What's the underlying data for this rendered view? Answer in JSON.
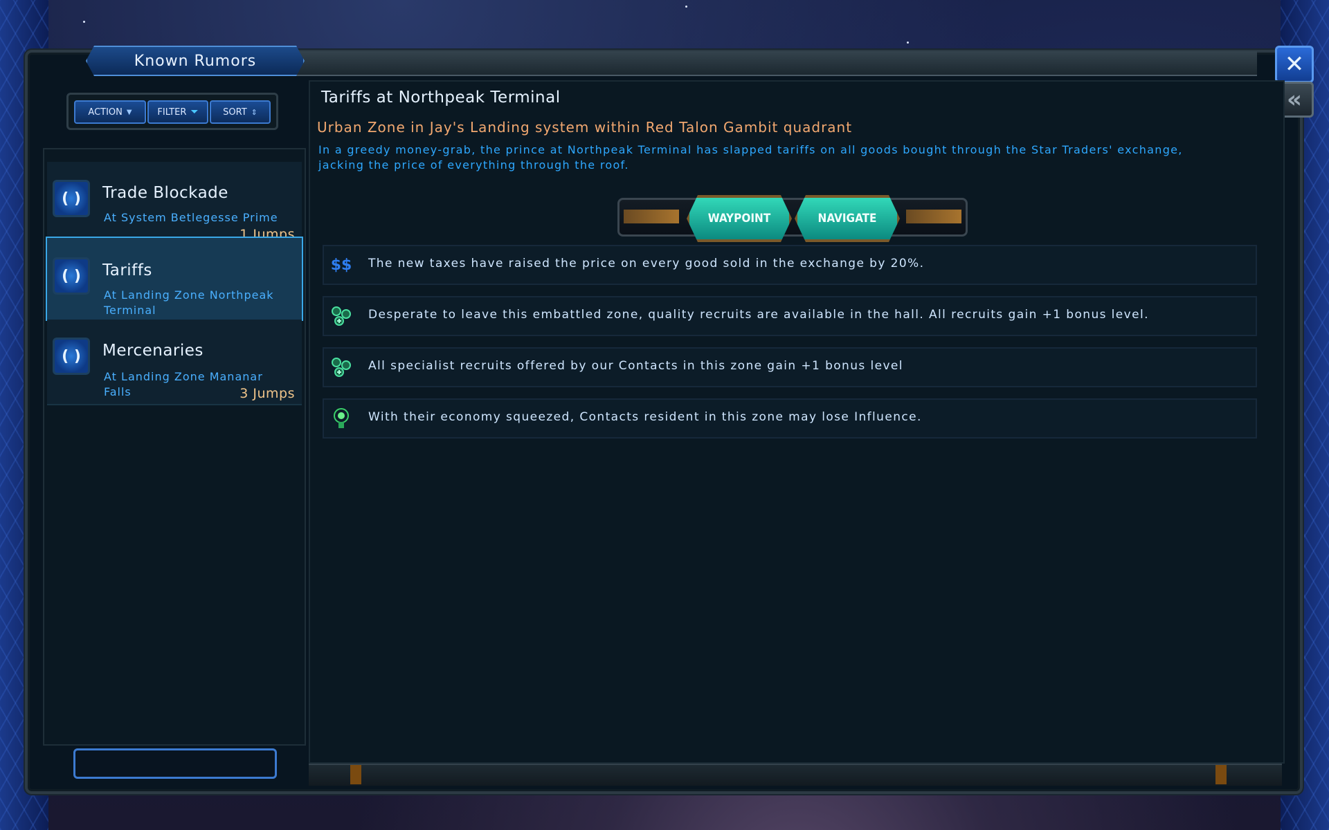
{
  "window": {
    "title": "Known Rumors"
  },
  "toolbar": {
    "action_label": "ACTION",
    "filter_label": "FILTER",
    "sort_label": "SORT"
  },
  "rumors": [
    {
      "title": "Trade Blockade",
      "location": "At System Betlegesse Prime",
      "jumps": "1 Jumps",
      "selected": false
    },
    {
      "title": "Tariffs",
      "location": "At Landing Zone Northpeak Terminal",
      "jumps": "",
      "selected": true
    },
    {
      "title": "Mercenaries",
      "location": "At Landing Zone Mananar Falls",
      "jumps": "3 Jumps",
      "selected": false
    }
  ],
  "detail": {
    "title": "Tariffs at Northpeak Terminal",
    "subtitle": "Urban Zone in Jay's Landing system within Red Talon Gambit quadrant",
    "description": "In a greedy money-grab, the prince at Northpeak Terminal has slapped tariffs on all goods bought through the Star Traders' exchange, jacking the price of everything through the roof.",
    "waypoint_label": "WAYPOINT",
    "navigate_label": "NAVIGATE",
    "effects": [
      {
        "icon": "dollar-icon",
        "text": "The new taxes have raised the price on every good sold in the exchange by 20%."
      },
      {
        "icon": "recruits-icon",
        "text": "Desperate to leave this embattled zone, quality recruits are available in the hall. All recruits gain +1 bonus level."
      },
      {
        "icon": "recruits-icon",
        "text": "All specialist recruits offered by our Contacts in this zone gain +1 bonus level"
      },
      {
        "icon": "influence-icon",
        "text": "With their economy squeezed, Contacts resident in this zone may lose Influence."
      }
    ]
  },
  "colors": {
    "accent_blue": "#2ea8ff",
    "subtitle_orange": "#f2a870",
    "jumps_gold": "#f0c48a",
    "button_teal": "#1fb89e"
  }
}
